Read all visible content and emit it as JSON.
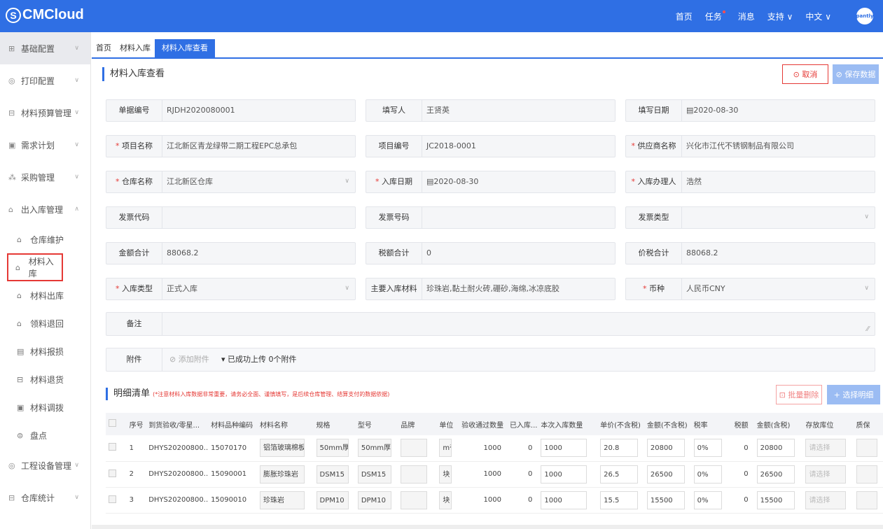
{
  "app": {
    "logo": "CMCloud",
    "logo_mark": "S"
  },
  "topnav": {
    "home": "首页",
    "tasks": "任务",
    "messages": "消息",
    "support": "支持 ∨",
    "lang": "中文 ∨",
    "avatar": "pantly"
  },
  "sidebar": {
    "items": [
      {
        "icon": "grid-icon",
        "glyph": "⊞",
        "label": "基础配置"
      },
      {
        "icon": "print-settings-icon",
        "glyph": "◎",
        "label": "打印配置"
      },
      {
        "icon": "budget-icon",
        "glyph": "⊟",
        "label": "材料预算管理"
      },
      {
        "icon": "plan-icon",
        "glyph": "▣",
        "label": "需求计划"
      },
      {
        "icon": "purchase-icon",
        "glyph": "⁂",
        "label": "采购管理"
      },
      {
        "icon": "warehouse-icon",
        "glyph": "⌂",
        "label": "出入库管理"
      }
    ],
    "subitems": [
      {
        "glyph": "⌂",
        "label": "仓库维护"
      },
      {
        "glyph": "⌂",
        "label": "材料入库"
      },
      {
        "glyph": "⌂",
        "label": "材料出库"
      },
      {
        "glyph": "⌂",
        "label": "领料退回"
      },
      {
        "glyph": "▤",
        "label": "材料报损"
      },
      {
        "glyph": "⊟",
        "label": "材料退货"
      },
      {
        "glyph": "▣",
        "label": "材料调拨"
      },
      {
        "glyph": "⊜",
        "label": "盘点"
      }
    ],
    "bottom": [
      {
        "glyph": "◎",
        "label": "工程设备管理"
      },
      {
        "glyph": "⊟",
        "label": "仓库统计"
      }
    ]
  },
  "breadcrumb": {
    "home": "首页",
    "parent": "材料入库",
    "current": "材料入库查看"
  },
  "page": {
    "title": "材料入库查看",
    "cancel": "⊙ 取消",
    "save": "⊘ 保存数据"
  },
  "form": {
    "doc_no": {
      "label": "单据编号",
      "value": "RJDH2020080001"
    },
    "writer": {
      "label": "填写人",
      "value": "王贤英"
    },
    "write_date": {
      "label": "填写日期",
      "value": "▤2020-08-30"
    },
    "project_name": {
      "label": "项目名称",
      "value": "江北新区青龙绿带二期工程EPC总承包"
    },
    "project_no": {
      "label": "项目编号",
      "value": "JC2018-0001"
    },
    "supplier": {
      "label": "供应商名称",
      "value": "兴化市江代不锈钢制品有限公司"
    },
    "warehouse": {
      "label": "仓库名称",
      "value": "江北新区仓库"
    },
    "in_date": {
      "label": "入库日期",
      "value": "▤2020-08-30"
    },
    "handler": {
      "label": "入库办理人",
      "value": "浩然"
    },
    "invoice_code": {
      "label": "发票代码",
      "value": ""
    },
    "invoice_no": {
      "label": "发票号码",
      "value": ""
    },
    "invoice_type": {
      "label": "发票类型",
      "value": ""
    },
    "amount_total": {
      "label": "金额合计",
      "value": "88068.2"
    },
    "tax_total": {
      "label": "税额合计",
      "value": "0"
    },
    "price_tax_total": {
      "label": "价税合计",
      "value": "88068.2"
    },
    "in_type": {
      "label": "入库类型",
      "value": "正式入库"
    },
    "main_materials": {
      "label": "主要入库材料",
      "value": "珍珠岩,黏土耐火砖,硼砂,海绵,冰凉底胶"
    },
    "currency": {
      "label": "币种",
      "value": "人民币CNY"
    },
    "remark": {
      "label": "备注",
      "value": ""
    },
    "attachment": {
      "label": "附件",
      "add": "⊘ 添加附件",
      "status": "▾  已成功上传 0个附件"
    }
  },
  "detail": {
    "title": "明细清单",
    "note": "(*注意材料入库数据非常重要，请务必全面、谨慎填写，是后续仓库管理、结算支付的数据依据)",
    "batch_delete": "⊡ 批量删除",
    "select": "+ 选择明细",
    "columns": [
      "序号",
      "到货验收/零星...",
      "材料品种编码",
      "材料名称",
      "规格",
      "型号",
      "品牌",
      "单位",
      "验收通过数量",
      "已入库...",
      "本次入库数量",
      "单价(不含税)",
      "金额(不含税)",
      "税率",
      "税额",
      "金额(含税)",
      "存放库位",
      "质保"
    ],
    "rows": [
      {
        "no": "1",
        "acc": "DHYS20200800...",
        "code": "15070170",
        "name": "铝箔玻璃棉板",
        "spec": "50mm厚",
        "model": "50mm厚",
        "brand": "",
        "unit": "m²",
        "passed": "1000",
        "stored": "0",
        "qty": "1000",
        "price": "20.8",
        "amount": "20800",
        "rate": "0%",
        "tax": "0",
        "amount_tax": "20800",
        "loc": "请选择"
      },
      {
        "no": "2",
        "acc": "DHYS20200800...",
        "code": "15090001",
        "name": "膨胀珍珠岩",
        "spec": "DSM15",
        "model": "DSM15",
        "brand": "",
        "unit": "块",
        "passed": "1000",
        "stored": "0",
        "qty": "1000",
        "price": "26.5",
        "amount": "26500",
        "rate": "0%",
        "tax": "0",
        "amount_tax": "26500",
        "loc": "请选择"
      },
      {
        "no": "3",
        "acc": "DHYS20200800...",
        "code": "15090010",
        "name": "珍珠岩",
        "spec": "DPM10",
        "model": "DPM10",
        "brand": "",
        "unit": "块",
        "passed": "1000",
        "stored": "0",
        "qty": "1000",
        "price": "15.5",
        "amount": "15500",
        "rate": "0%",
        "tax": "0",
        "amount_tax": "15500",
        "loc": "请选择"
      }
    ]
  }
}
